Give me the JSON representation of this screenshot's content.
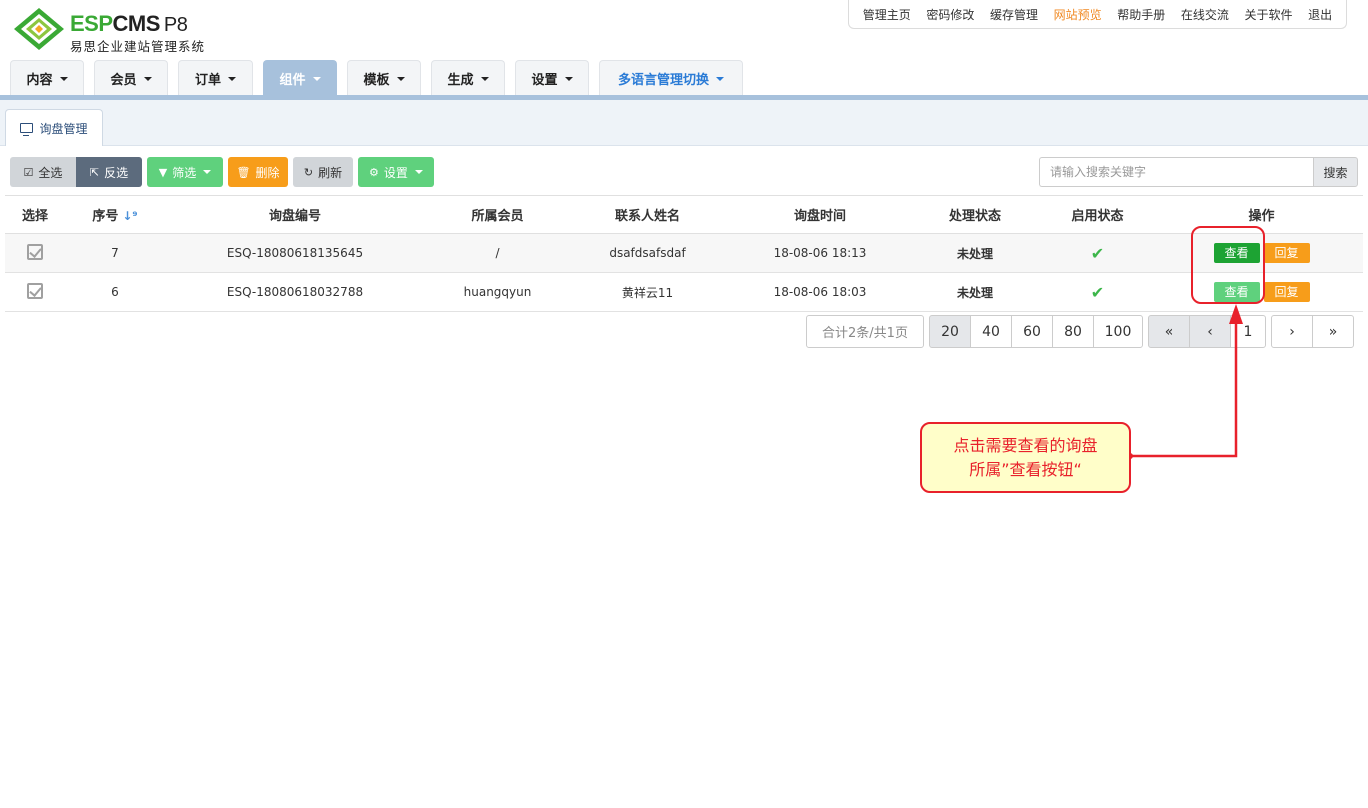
{
  "logo": {
    "brand_esp": "ESP",
    "brand_cms": "CMS",
    "brand_ver": "P8",
    "subtitle": "易思企业建站管理系统"
  },
  "toplinks": [
    "管理主页",
    "密码修改",
    "缓存管理",
    "网站预览",
    "帮助手册",
    "在线交流",
    "关于软件",
    "退出"
  ],
  "nav": [
    "内容",
    "会员",
    "订单",
    "组件",
    "模板",
    "生成",
    "设置",
    "多语言管理切换"
  ],
  "tab": "询盘管理",
  "toolbar": {
    "select_all": "全选",
    "invert": "反选",
    "filter": "筛选",
    "delete": "删除",
    "refresh": "刷新",
    "settings": "设置"
  },
  "search": {
    "placeholder": "请输入搜索关键字",
    "button": "搜索"
  },
  "table": {
    "headers": [
      "选择",
      "序号",
      "询盘编号",
      "所属会员",
      "联系人姓名",
      "询盘时间",
      "处理状态",
      "启用状态",
      "操作"
    ],
    "rows": [
      {
        "id": "7",
        "code": "ESQ-18080618135645",
        "member": "/",
        "contact": "dsafdsafsdaf",
        "time": "18-08-06 18:13",
        "status": "未处理",
        "view": "查看",
        "reply": "回复"
      },
      {
        "id": "6",
        "code": "ESQ-18080618032788",
        "member": "huangqyun",
        "contact": "黄祥云11",
        "time": "18-08-06 18:03",
        "status": "未处理",
        "view": "查看",
        "reply": "回复"
      }
    ]
  },
  "pager": {
    "total": "合计2条/共1页",
    "sizes": [
      "20",
      "40",
      "60",
      "80",
      "100"
    ],
    "first": "«",
    "prev": "‹",
    "page": "1",
    "next": "›",
    "last": "»"
  },
  "annotation": {
    "line1": "点击需要查看的询盘",
    "line2": "所属”查看按钮“"
  },
  "colors": {
    "accent_blue": "#a7c1dc",
    "green": "#1da333",
    "light_green": "#5fd17d",
    "orange": "#f79d1a",
    "red": "#e8212b",
    "callout_bg": "#fffec9"
  }
}
